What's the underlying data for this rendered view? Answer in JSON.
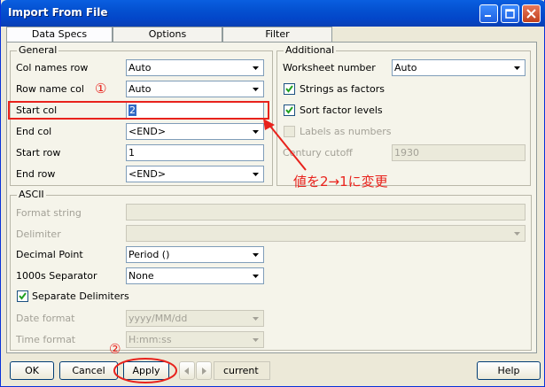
{
  "window": {
    "title": "Import From File"
  },
  "tabs": [
    {
      "label": "Data Specs",
      "active": true
    },
    {
      "label": "Options",
      "active": false
    },
    {
      "label": "Filter",
      "active": false
    }
  ],
  "general": {
    "label": "General",
    "col_names_row": {
      "label": "Col names row",
      "value": "Auto"
    },
    "row_name_col": {
      "label": "Row name col",
      "value": "Auto"
    },
    "start_col": {
      "label": "Start col",
      "value": "2"
    },
    "end_col": {
      "label": "End col",
      "value": "<END>"
    },
    "start_row": {
      "label": "Start row",
      "value": "1"
    },
    "end_row": {
      "label": "End row",
      "value": "<END>"
    }
  },
  "additional": {
    "label": "Additional",
    "worksheet_number": {
      "label": "Worksheet number",
      "value": "Auto"
    },
    "strings_as_factors": {
      "label": "Strings as factors",
      "checked": true
    },
    "sort_factor_levels": {
      "label": "Sort factor levels",
      "checked": true
    },
    "labels_as_numbers": {
      "label": "Labels as numbers",
      "checked": false
    },
    "century_cutoff": {
      "label": "Century cutoff",
      "value": "1930"
    }
  },
  "ascii": {
    "label": "ASCII",
    "format_string": {
      "label": "Format string",
      "value": ""
    },
    "delimiter": {
      "label": "Delimiter",
      "value": ""
    },
    "decimal_point": {
      "label": "Decimal Point",
      "value": "Period ()"
    },
    "separator": {
      "label": "1000s Separator",
      "value": "None"
    },
    "separate_delimiters": {
      "label": "Separate Delimiters",
      "checked": true
    },
    "date_format": {
      "label": "Date format",
      "value": "yyyy/MM/dd"
    },
    "time_format": {
      "label": "Time format",
      "value": "H:mm:ss"
    }
  },
  "annotations": {
    "circle1": "①",
    "circle2": "②",
    "note": "値を2→1に変更"
  },
  "buttons": {
    "ok": "OK",
    "cancel": "Cancel",
    "apply": "Apply",
    "current": "current",
    "help": "Help"
  },
  "colors": {
    "annotation": "#e8221c",
    "titlebar": "#0a5fe0"
  }
}
